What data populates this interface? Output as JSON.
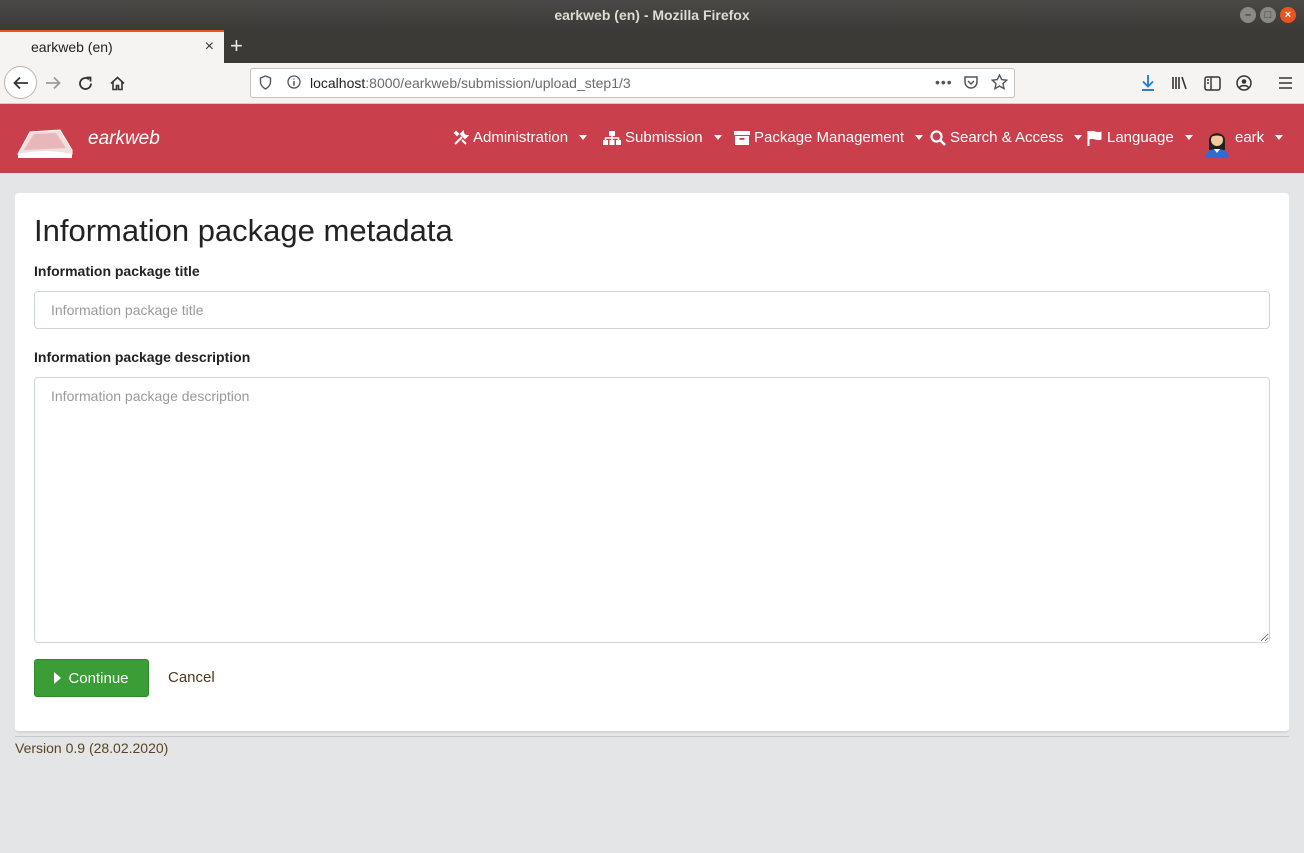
{
  "window": {
    "title": "earkweb (en) - Mozilla Firefox"
  },
  "tab": {
    "title": "earkweb (en)",
    "close": "×",
    "new": "+"
  },
  "url": {
    "host": "localhost",
    "path": ":8000/earkweb/submission/upload_step1/3",
    "more": "•••"
  },
  "app": {
    "brand": "earkweb",
    "menus": [
      {
        "label": "Administration",
        "icon": "wrench-icon"
      },
      {
        "label": "Submission",
        "icon": "sitemap-icon"
      },
      {
        "label": "Package Management",
        "icon": "archive-icon"
      },
      {
        "label": "Search & Access",
        "icon": "search-icon"
      },
      {
        "label": "Language",
        "icon": "flag-icon"
      },
      {
        "label": "eark",
        "icon": "user-avatar"
      }
    ],
    "accent_color": "#c9404c"
  },
  "form": {
    "heading": "Information package metadata",
    "title_label": "Information package title",
    "title_placeholder": "Information package title",
    "title_value": "",
    "description_label": "Information package description",
    "description_placeholder": "Information package description",
    "description_value": "",
    "continue_label": "Continue",
    "cancel_label": "Cancel"
  },
  "footer": {
    "version": "Version 0.9 (28.02.2020)"
  }
}
